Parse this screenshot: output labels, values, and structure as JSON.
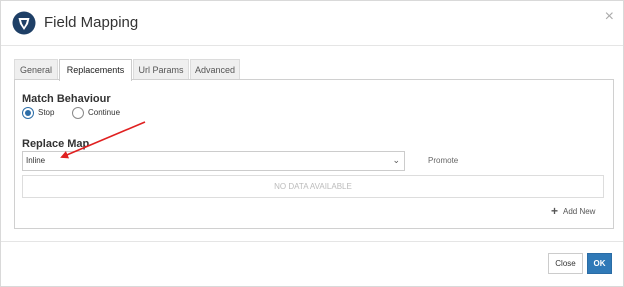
{
  "dialog": {
    "title": "Field Mapping",
    "close_symbol": "×",
    "logo_icon": "shield-logo-icon"
  },
  "tabs": [
    {
      "label": "General",
      "active": false
    },
    {
      "label": "Replacements",
      "active": true
    },
    {
      "label": "Url Params",
      "active": false
    },
    {
      "label": "Advanced",
      "active": false
    }
  ],
  "match_behaviour": {
    "title": "Match Behaviour",
    "options": [
      {
        "label": "Stop",
        "checked": true
      },
      {
        "label": "Continue",
        "checked": false
      }
    ]
  },
  "replace_map": {
    "title": "Replace Map",
    "selected_value": "Inline",
    "chevron": "⌄",
    "promote_label": "Promote",
    "empty_text": "NO DATA AVAILABLE",
    "add_new_label": "Add New",
    "add_new_icon": "+"
  },
  "footer": {
    "close_label": "Close",
    "ok_label": "OK"
  },
  "colors": {
    "accent": "#2f79b7",
    "arrow": "#e02020",
    "logo": "#1e3f66"
  }
}
